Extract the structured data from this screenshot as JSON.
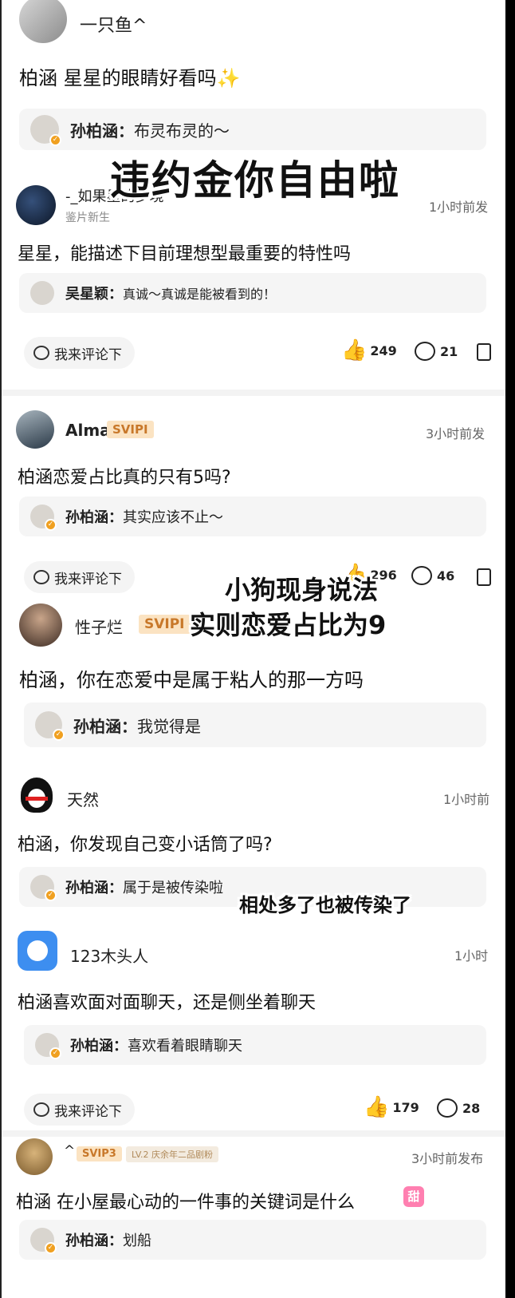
{
  "posts": [
    {
      "user": "一只鱼^",
      "question": "柏涵 星星的眼睛好看吗✨",
      "reply_name": "孙柏涵：",
      "reply_text": "布灵布灵的～"
    },
    {
      "user": "-_如果星的梦境",
      "sub": "鉴片新生",
      "time": "1小时前发",
      "question": "星星，能描述下目前理想型最重要的特性吗",
      "reply_name": "吴星颖：",
      "reply_text": "真诚～真诚是能被看到的！",
      "comment_label": "我来评论下",
      "likes": "249",
      "comments": "21"
    },
    {
      "user": "Alma",
      "badge": "SVIPI",
      "time": "3小时前发",
      "question": "柏涵恋爱占比真的只有5吗?",
      "reply_name": "孙柏涵：",
      "reply_text": "其实应该不止～",
      "comment_label": "我来评论下",
      "likes": "296",
      "comments": "46"
    },
    {
      "user": "性子烂",
      "badge": "SVIPI",
      "question": "柏涵，你在恋爱中是属于粘人的那一方吗",
      "reply_name": "孙柏涵：",
      "reply_text": "我觉得是"
    },
    {
      "user": "天然",
      "time": "1小时前",
      "question": "柏涵，你发现自己变小话筒了吗?",
      "reply_name": "孙柏涵：",
      "reply_text": "属于是被传染啦"
    },
    {
      "user": "123木头人",
      "time": "1小时",
      "question": "柏涵喜欢面对面聊天，还是侧坐着聊天",
      "reply_name": "孙柏涵：",
      "reply_text": "喜欢看着眼睛聊天",
      "comment_label": "我来评论下",
      "likes": "179",
      "comments": "28"
    },
    {
      "user": "^",
      "badge": "SVIP3",
      "badge2": "LV.2 庆余年二品剧粉",
      "time": "3小时前发布",
      "question": "柏涵 在小屋最心动的一件事的关键词是什么",
      "emoji_badge": "甜",
      "reply_name": "孙柏涵：",
      "reply_text": "划船"
    }
  ],
  "overlays": {
    "caption1": "违约金你自由啦",
    "caption2_line1": "小狗现身说法",
    "caption2_line2": "实则恋爱占比为9",
    "caption3": "相处多了也被传染了"
  },
  "colors": {
    "badge_bg": "#fbe3c2",
    "badge_text": "#c8782a",
    "thumb": "#f3a81a",
    "reply_bg": "#f5f5f5"
  }
}
